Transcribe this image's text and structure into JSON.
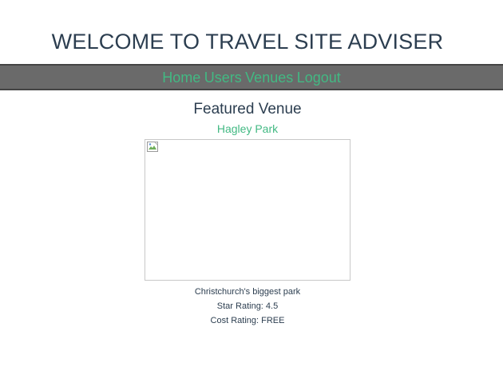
{
  "header": {
    "title": "WELCOME TO TRAVEL SITE ADVISER"
  },
  "nav": {
    "items": [
      {
        "label": "Home"
      },
      {
        "label": "Users"
      },
      {
        "label": "Venues"
      },
      {
        "label": "Logout"
      }
    ]
  },
  "featured": {
    "heading": "Featured Venue",
    "venue_name": "Hagley Park",
    "image_icon": "broken-image-icon",
    "description": "Christchurch's biggest park",
    "star_rating": "Star Rating: 4.5",
    "cost_rating": "Cost Rating: FREE"
  },
  "colors": {
    "accent": "#42b983",
    "text": "#2c3e50",
    "navbar_bg": "#6a6a6a"
  }
}
